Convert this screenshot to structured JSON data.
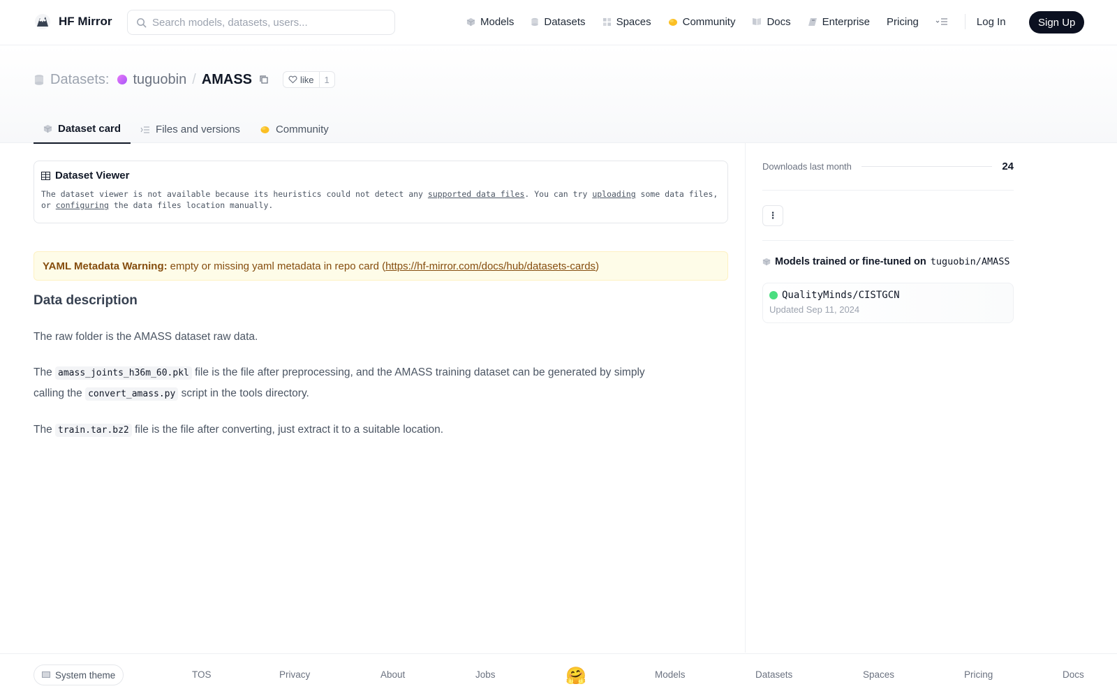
{
  "header": {
    "brand": "HF Mirror",
    "search_placeholder": "Search models, datasets, users...",
    "nav": [
      {
        "label": "Models",
        "icon": "cube-icon"
      },
      {
        "label": "Datasets",
        "icon": "database-icon"
      },
      {
        "label": "Spaces",
        "icon": "grid-icon"
      },
      {
        "label": "Community",
        "icon": "hand-icon"
      },
      {
        "label": "Docs",
        "icon": "book-icon"
      },
      {
        "label": "Enterprise",
        "icon": "tag-icon"
      },
      {
        "label": "Pricing"
      }
    ],
    "login": "Log In",
    "signup": "Sign Up"
  },
  "repo": {
    "kind": "Datasets:",
    "owner": "tuguobin",
    "sep": "/",
    "name": "AMASS",
    "like_label": "like",
    "like_count": "1"
  },
  "tabs": [
    {
      "label": "Dataset card",
      "active": true
    },
    {
      "label": "Files and versions"
    },
    {
      "label": "Community"
    }
  ],
  "viewer": {
    "title": "Dataset Viewer",
    "text_1": "The dataset viewer is not available because its heuristics could not detect any ",
    "link_1": "supported data files",
    "text_2": ". You can try ",
    "link_2": "uploading",
    "text_3": " some data files, or ",
    "link_3": "configuring",
    "text_4": " the data files location manually."
  },
  "warning": {
    "label": "YAML Metadata Warning:",
    "text": "empty or missing yaml metadata in repo card (",
    "link": "https://hf-mirror.com/docs/hub/datasets-cards",
    "close": ")"
  },
  "content": {
    "heading": "Data description",
    "p1": "The raw folder is the AMASS dataset raw data.",
    "p2_a": "The ",
    "p2_code": "amass_joints_h36m_60.pkl",
    "p2_b": " file is the file after preprocessing, and the AMASS training dataset can be generated by simply calling the ",
    "p2_code2": "convert_amass.py",
    "p2_c": " script in the tools directory.",
    "p3_a": "The ",
    "p3_code": "train.tar.bz2",
    "p3_b": " file is the file after converting, just extract it to a suitable location."
  },
  "sidebar": {
    "downloads_label": "Downloads last month",
    "downloads_value": "24",
    "menu_dots": "⋮",
    "models_title": "Models trained or fine-tuned on",
    "models_repo": "tuguobin/AMASS",
    "model_name": "QualityMinds/CISTGCN",
    "model_updated": "Updated Sep 11, 2024"
  },
  "footer": {
    "theme": "System theme",
    "links": [
      "TOS",
      "Privacy",
      "About",
      "Jobs",
      "Models",
      "Datasets",
      "Spaces",
      "Pricing",
      "Docs"
    ]
  },
  "colors": {
    "accent_dark": "#0b1020",
    "warning_bg": "#fefce8",
    "warning_text": "#854d0e"
  }
}
